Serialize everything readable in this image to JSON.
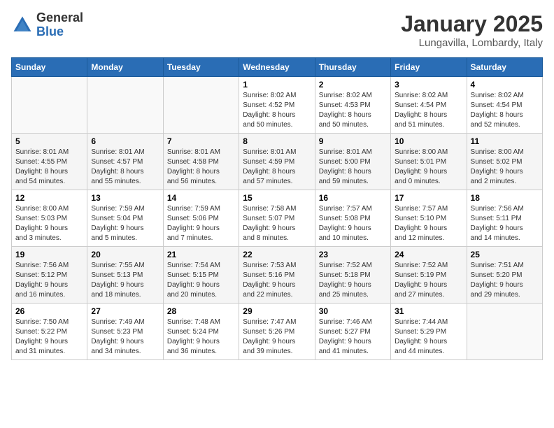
{
  "header": {
    "logo_general": "General",
    "logo_blue": "Blue",
    "month": "January 2025",
    "location": "Lungavilla, Lombardy, Italy"
  },
  "days_of_week": [
    "Sunday",
    "Monday",
    "Tuesday",
    "Wednesday",
    "Thursday",
    "Friday",
    "Saturday"
  ],
  "weeks": [
    [
      {
        "day": "",
        "info": ""
      },
      {
        "day": "",
        "info": ""
      },
      {
        "day": "",
        "info": ""
      },
      {
        "day": "1",
        "info": "Sunrise: 8:02 AM\nSunset: 4:52 PM\nDaylight: 8 hours\nand 50 minutes."
      },
      {
        "day": "2",
        "info": "Sunrise: 8:02 AM\nSunset: 4:53 PM\nDaylight: 8 hours\nand 50 minutes."
      },
      {
        "day": "3",
        "info": "Sunrise: 8:02 AM\nSunset: 4:54 PM\nDaylight: 8 hours\nand 51 minutes."
      },
      {
        "day": "4",
        "info": "Sunrise: 8:02 AM\nSunset: 4:54 PM\nDaylight: 8 hours\nand 52 minutes."
      }
    ],
    [
      {
        "day": "5",
        "info": "Sunrise: 8:01 AM\nSunset: 4:55 PM\nDaylight: 8 hours\nand 54 minutes."
      },
      {
        "day": "6",
        "info": "Sunrise: 8:01 AM\nSunset: 4:57 PM\nDaylight: 8 hours\nand 55 minutes."
      },
      {
        "day": "7",
        "info": "Sunrise: 8:01 AM\nSunset: 4:58 PM\nDaylight: 8 hours\nand 56 minutes."
      },
      {
        "day": "8",
        "info": "Sunrise: 8:01 AM\nSunset: 4:59 PM\nDaylight: 8 hours\nand 57 minutes."
      },
      {
        "day": "9",
        "info": "Sunrise: 8:01 AM\nSunset: 5:00 PM\nDaylight: 8 hours\nand 59 minutes."
      },
      {
        "day": "10",
        "info": "Sunrise: 8:00 AM\nSunset: 5:01 PM\nDaylight: 9 hours\nand 0 minutes."
      },
      {
        "day": "11",
        "info": "Sunrise: 8:00 AM\nSunset: 5:02 PM\nDaylight: 9 hours\nand 2 minutes."
      }
    ],
    [
      {
        "day": "12",
        "info": "Sunrise: 8:00 AM\nSunset: 5:03 PM\nDaylight: 9 hours\nand 3 minutes."
      },
      {
        "day": "13",
        "info": "Sunrise: 7:59 AM\nSunset: 5:04 PM\nDaylight: 9 hours\nand 5 minutes."
      },
      {
        "day": "14",
        "info": "Sunrise: 7:59 AM\nSunset: 5:06 PM\nDaylight: 9 hours\nand 7 minutes."
      },
      {
        "day": "15",
        "info": "Sunrise: 7:58 AM\nSunset: 5:07 PM\nDaylight: 9 hours\nand 8 minutes."
      },
      {
        "day": "16",
        "info": "Sunrise: 7:57 AM\nSunset: 5:08 PM\nDaylight: 9 hours\nand 10 minutes."
      },
      {
        "day": "17",
        "info": "Sunrise: 7:57 AM\nSunset: 5:10 PM\nDaylight: 9 hours\nand 12 minutes."
      },
      {
        "day": "18",
        "info": "Sunrise: 7:56 AM\nSunset: 5:11 PM\nDaylight: 9 hours\nand 14 minutes."
      }
    ],
    [
      {
        "day": "19",
        "info": "Sunrise: 7:56 AM\nSunset: 5:12 PM\nDaylight: 9 hours\nand 16 minutes."
      },
      {
        "day": "20",
        "info": "Sunrise: 7:55 AM\nSunset: 5:13 PM\nDaylight: 9 hours\nand 18 minutes."
      },
      {
        "day": "21",
        "info": "Sunrise: 7:54 AM\nSunset: 5:15 PM\nDaylight: 9 hours\nand 20 minutes."
      },
      {
        "day": "22",
        "info": "Sunrise: 7:53 AM\nSunset: 5:16 PM\nDaylight: 9 hours\nand 22 minutes."
      },
      {
        "day": "23",
        "info": "Sunrise: 7:52 AM\nSunset: 5:18 PM\nDaylight: 9 hours\nand 25 minutes."
      },
      {
        "day": "24",
        "info": "Sunrise: 7:52 AM\nSunset: 5:19 PM\nDaylight: 9 hours\nand 27 minutes."
      },
      {
        "day": "25",
        "info": "Sunrise: 7:51 AM\nSunset: 5:20 PM\nDaylight: 9 hours\nand 29 minutes."
      }
    ],
    [
      {
        "day": "26",
        "info": "Sunrise: 7:50 AM\nSunset: 5:22 PM\nDaylight: 9 hours\nand 31 minutes."
      },
      {
        "day": "27",
        "info": "Sunrise: 7:49 AM\nSunset: 5:23 PM\nDaylight: 9 hours\nand 34 minutes."
      },
      {
        "day": "28",
        "info": "Sunrise: 7:48 AM\nSunset: 5:24 PM\nDaylight: 9 hours\nand 36 minutes."
      },
      {
        "day": "29",
        "info": "Sunrise: 7:47 AM\nSunset: 5:26 PM\nDaylight: 9 hours\nand 39 minutes."
      },
      {
        "day": "30",
        "info": "Sunrise: 7:46 AM\nSunset: 5:27 PM\nDaylight: 9 hours\nand 41 minutes."
      },
      {
        "day": "31",
        "info": "Sunrise: 7:44 AM\nSunset: 5:29 PM\nDaylight: 9 hours\nand 44 minutes."
      },
      {
        "day": "",
        "info": ""
      }
    ]
  ]
}
